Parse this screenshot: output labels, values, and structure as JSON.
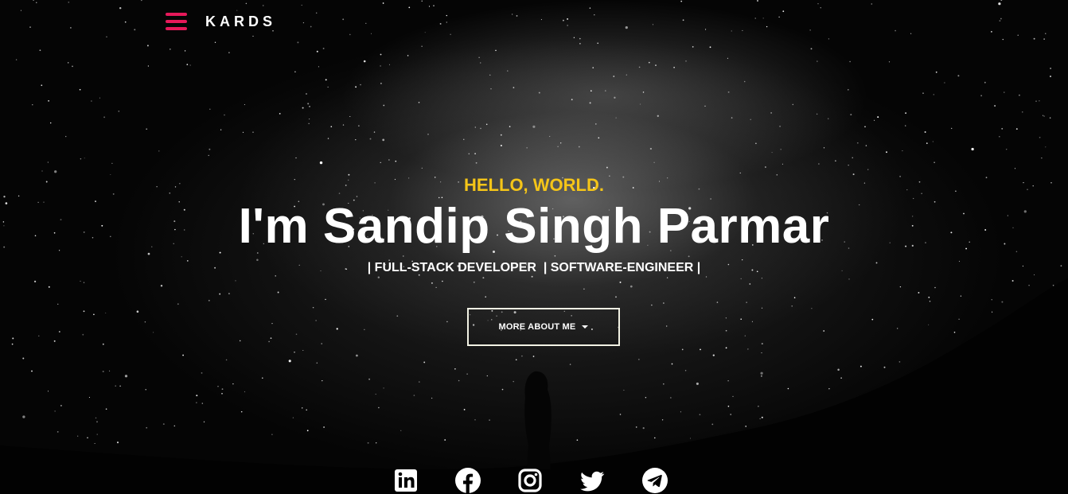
{
  "header": {
    "logo": "KARDS",
    "menu_icon": "hamburger-menu-icon",
    "accent_color": "#e6195a"
  },
  "hero": {
    "greeting": "HELLO, WORLD.",
    "greeting_color": "#f5c518",
    "heading": "I'm Sandip Singh Parmar",
    "roles": "| FULL-STACK DEVELOPER  | SOFTWARE-ENGINEER |",
    "cta_label": "MORE ABOUT ME",
    "cta_icon": "caret-down-icon"
  },
  "social": [
    {
      "name": "linkedin-icon"
    },
    {
      "name": "facebook-icon"
    },
    {
      "name": "instagram-icon"
    },
    {
      "name": "twitter-icon"
    },
    {
      "name": "telegram-icon"
    }
  ]
}
